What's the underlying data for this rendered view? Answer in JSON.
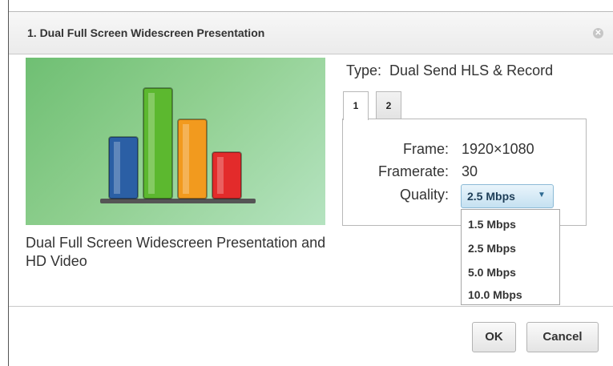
{
  "dialog": {
    "title": "1. Dual Full Screen Widescreen Presentation",
    "close_icon": "close-icon"
  },
  "preview": {
    "icon": "bar-chart-icon",
    "description": "Dual Full Screen Widescreen Presentation and HD Video",
    "bar_colors": [
      "#2b5fa5",
      "#5cb82f",
      "#f29a1e",
      "#e32b2b"
    ],
    "bar_levels": [
      0.48,
      0.86,
      0.62,
      0.36
    ]
  },
  "config": {
    "type_label": "Type:",
    "type_value": "Dual Send HLS & Record",
    "tabs": [
      {
        "label": "1",
        "active": true
      },
      {
        "label": "2",
        "active": false
      }
    ],
    "frame_label": "Frame:",
    "frame_value": "1920×1080",
    "framerate_label": "Framerate:",
    "framerate_value": "30",
    "quality_label": "Quality:",
    "quality_value": "2.5 Mbps",
    "quality_options": [
      "1.5 Mbps",
      "2.5 Mbps",
      "5.0 Mbps",
      "10.0 Mbps"
    ]
  },
  "buttons": {
    "ok": "OK",
    "cancel": "Cancel"
  },
  "colors": {
    "preview_bg": "#8fcf8f",
    "select_bg": "#d6ebf7"
  }
}
